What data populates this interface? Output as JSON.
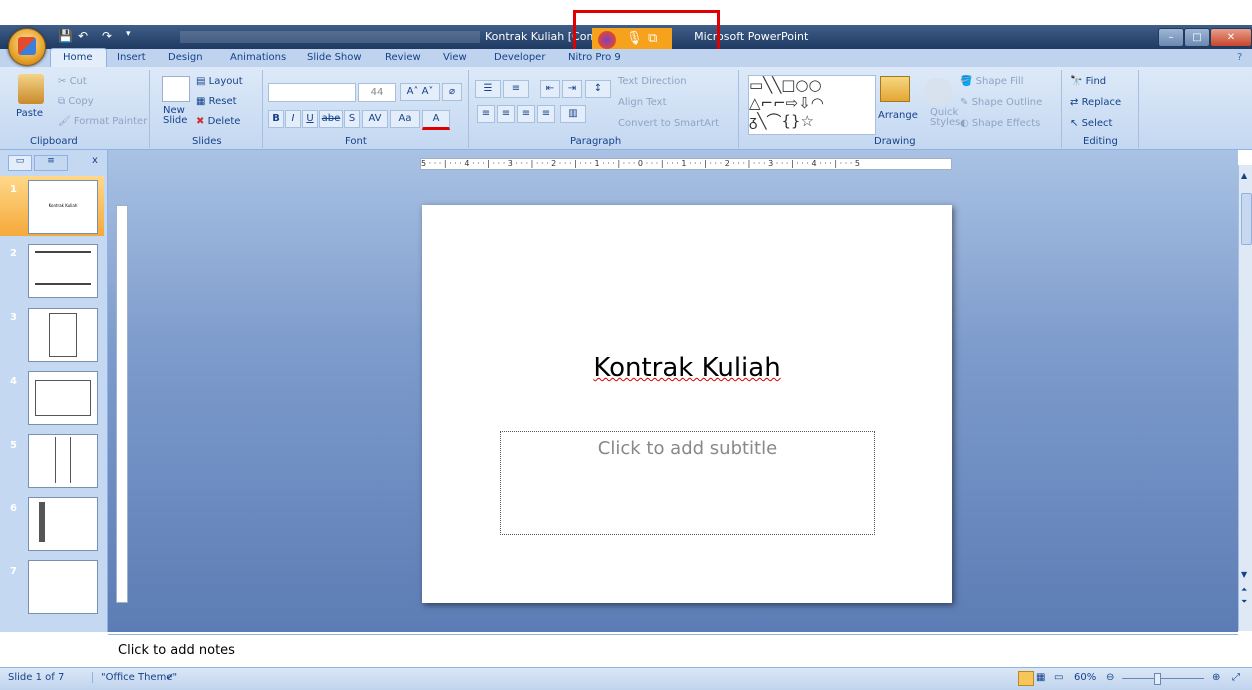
{
  "window": {
    "title_left": "Kontrak Kuliah [Comp",
    "title_right": "Microsoft PowerPoint",
    "min": "–",
    "max": "□",
    "close": "✕"
  },
  "tabs": [
    "Home",
    "Insert",
    "Design",
    "Animations",
    "Slide Show",
    "Review",
    "View",
    "Developer",
    "Nitro Pro 9"
  ],
  "ribbon": {
    "clipboard": {
      "label": "Clipboard",
      "paste": "Paste",
      "cut": "Cut",
      "copy": "Copy",
      "format_painter": "Format Painter"
    },
    "slides": {
      "label": "Slides",
      "new_slide": "New",
      "new_slide2": "Slide",
      "layout": "Layout",
      "reset": "Reset",
      "delete": "Delete"
    },
    "font": {
      "label": "Font",
      "size": "44",
      "bold": "B",
      "italic": "I",
      "underline": "U",
      "strike": "abe",
      "shadow": "S",
      "spacing": "AV",
      "case": "Aa",
      "color": "A"
    },
    "paragraph": {
      "label": "Paragraph",
      "text_direction": "Text Direction",
      "align_text": "Align Text",
      "convert": "Convert to SmartArt"
    },
    "drawing": {
      "label": "Drawing",
      "arrange": "Arrange",
      "quick": "Quick",
      "styles": "Styles",
      "shape_fill": "Shape Fill",
      "shape_outline": "Shape Outline",
      "shape_effects": "Shape Effects"
    },
    "editing": {
      "label": "Editing",
      "find": "Find",
      "replace": "Replace",
      "select": "Select"
    }
  },
  "thumbnails": [
    "1",
    "2",
    "3",
    "4",
    "5",
    "6",
    "7"
  ],
  "thumb1_text": "Kontrak Kuliah",
  "ruler_text": "5 · · · | · · · 4 · · · | · · · 3 · · · | · · · 2 · · · | · · · 1 · · · | · · · 0 · · · | · · · 1 · · · | · · · 2 · · · | · · · 3 · · · | · · · 4 · · · | · · · 5",
  "slide": {
    "title": "Kontrak Kuliah",
    "subtitle_placeholder": "Click to add subtitle"
  },
  "notes_placeholder": "Click to add notes",
  "status": {
    "slide": "Slide 1 of 7",
    "theme": "\"Office Theme\"",
    "zoom": "60%"
  },
  "colors": {
    "accent": "#f7a21d",
    "highlight": "#e00000"
  }
}
